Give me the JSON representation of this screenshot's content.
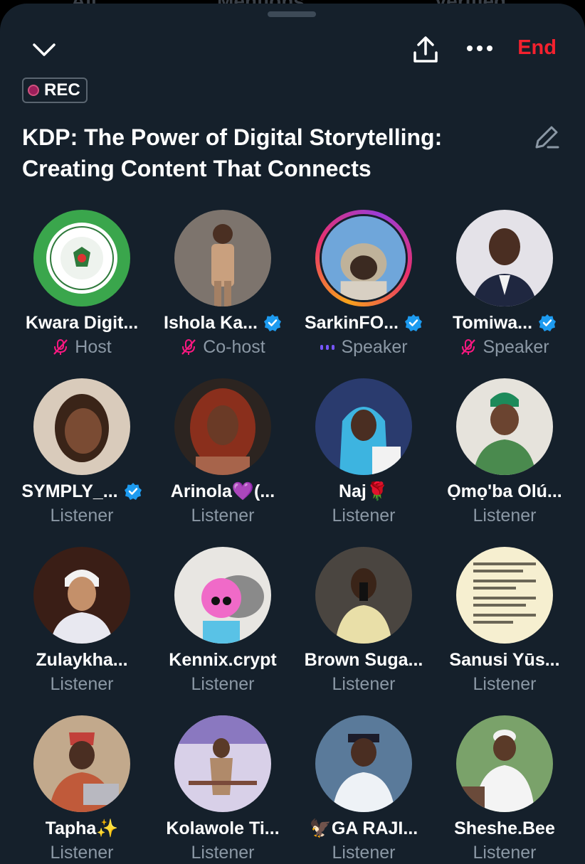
{
  "background_tabs": [
    "All",
    "Mentions",
    "Verified"
  ],
  "header": {
    "end_label": "End"
  },
  "rec_label": "REC",
  "space_title": "KDP: The Power of Digital Storytelling: Creating Content That Connects",
  "colors": {
    "sheet": "#15202b",
    "end": "#f4212e",
    "verified": "#1d9bf0",
    "muted_role": "#8b98a5",
    "mic_off": "#f91880",
    "speaking": "#7856ff"
  },
  "participants": [
    {
      "name": "Kwara Digit...",
      "role": "Host",
      "verified": false,
      "status": "mic-off"
    },
    {
      "name": "Ishola Ka...",
      "role": "Co-host",
      "verified": true,
      "status": "mic-off"
    },
    {
      "name": "SarkinFO...",
      "role": "Speaker",
      "verified": true,
      "status": "speaking"
    },
    {
      "name": "Tomiwa...",
      "role": "Speaker",
      "verified": true,
      "status": "mic-off"
    },
    {
      "name": "SYMPLY_...",
      "role": "Listener",
      "verified": true,
      "status": ""
    },
    {
      "name": "Arinola💜(...",
      "role": "Listener",
      "verified": false,
      "status": ""
    },
    {
      "name": "Naj🌹",
      "role": "Listener",
      "verified": false,
      "status": ""
    },
    {
      "name": "Ọmọ'ba Olú...",
      "role": "Listener",
      "verified": false,
      "status": ""
    },
    {
      "name": "Zulaykha...",
      "role": "Listener",
      "verified": false,
      "status": ""
    },
    {
      "name": "Kennix.crypt",
      "role": "Listener",
      "verified": false,
      "status": ""
    },
    {
      "name": "Brown Suga...",
      "role": "Listener",
      "verified": false,
      "status": ""
    },
    {
      "name": "Sanusi Yūs...",
      "role": "Listener",
      "verified": false,
      "status": ""
    },
    {
      "name": "Tapha✨",
      "role": "Listener",
      "verified": false,
      "status": ""
    },
    {
      "name": "Kolawole Ti...",
      "role": "Listener",
      "verified": false,
      "status": ""
    },
    {
      "name": "🦅GA RAJI...",
      "role": "Listener",
      "verified": false,
      "status": ""
    },
    {
      "name": "Sheshe.Bee",
      "role": "Listener",
      "verified": false,
      "status": ""
    }
  ]
}
